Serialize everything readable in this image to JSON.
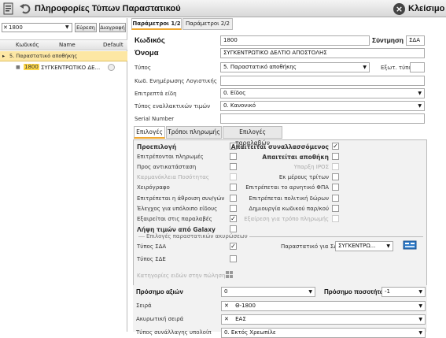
{
  "window": {
    "title": "Πληροφορίες Τύπων Παραστατικού",
    "close_label": "Κλείσιμο"
  },
  "left": {
    "search_value": "1800",
    "search_btn": "Εύρεση",
    "delete_btn": "Διαγραφή",
    "columns": [
      "Κωδικός",
      "Name",
      "Default"
    ],
    "group_label": "5. Παραστατικό αποθήκης",
    "row": {
      "code": "1800",
      "name": "ΣΥΓΚΕΝΤΡΩΤΙΚΟ ΔΕ..."
    }
  },
  "tabs": [
    "Παράμετροι 1/2",
    "Παράμετροι 2/2"
  ],
  "form": {
    "code_label": "Κωδικός",
    "code_value": "1800",
    "synt_label": "Σύντμηση",
    "synt_value": "ΣΔΑ",
    "name_label": "Όνομα",
    "name_value": "ΣΥΓΚΕΝΤΡΩΤΙΚΟ ΔΕΛΤΙΟ ΑΠΟΣΤΟΛΗΣ",
    "type_label": "Τύπος",
    "type_value": "5. Παραστατικό αποθήκης",
    "ext_type_label": "Εξωτ. τύπος",
    "acc_label": "Κωδ. Ενημέρωσης Λογιστικής",
    "items_label": "Επιτρεπτά είδη",
    "items_value": "0. Είδος",
    "alt_price_label": "Τύπος εναλλακτικών τιμών",
    "alt_price_value": "0. Κανονικό",
    "serial_label": "Serial Number"
  },
  "inner_tabs": [
    "Επιλογές",
    "Τρόποι πληρωμής",
    "Επιλογές παραλαβών"
  ],
  "options_left": [
    {
      "label": "Προεπιλογή",
      "checked": false,
      "bold": true
    },
    {
      "label": "Επιτρέπονται πληρωμές",
      "checked": false
    },
    {
      "label": "Προς αντικατάσταση",
      "checked": false
    },
    {
      "label": "Καρμανόκλεια Ποσότητας",
      "checked": false,
      "disabled": true
    },
    {
      "label": "Χειρόγραφο",
      "checked": false
    },
    {
      "label": "Επιτρέπεται η άθροιση συν/γών",
      "checked": false
    },
    {
      "label": "Έλεγχος για υπόλοιπο είδους",
      "checked": false
    },
    {
      "label": "Εξαιρείται στις παραλαβές",
      "checked": true
    },
    {
      "label": "Λήψη τιμών από Galaxy",
      "checked": false,
      "bold": true
    }
  ],
  "options_right": [
    {
      "label": "Απαιτείται συναλλασσόμενος",
      "checked": true,
      "bold": true
    },
    {
      "label": "Απαιτείται αποθήκη",
      "checked": false,
      "bold": true
    },
    {
      "label": "Υπαρξη ΙΡΟΣ",
      "checked": false,
      "disabled": true
    },
    {
      "label": "Εκ μέρους τρίτων",
      "checked": false
    },
    {
      "label": "Επιτρέπεται το αρνητικό ΦΠΑ",
      "checked": false
    },
    {
      "label": "Επιτρέπεται πολιτική δώρων",
      "checked": false
    },
    {
      "label": "Δημιουργία κωδικού παρ/κού",
      "checked": false
    },
    {
      "label": "Εξαίρεση για τρόπο πληρωμής",
      "checked": false,
      "disabled": true
    }
  ],
  "sub_group": {
    "title": "Επιλογές παραστατικών ακυρώσεων",
    "type_sda_label": "Τύπος ΣΔΑ",
    "type_sda_checked": true,
    "type_sde_label": "Τύπος ΣΔΕ",
    "type_sde_checked": false,
    "doc_for_sde_label": "Παραστατικό για ΣΔΕ",
    "doc_for_sde_value": "ΣΥΓΚΕΝΤΡΩ..."
  },
  "categories_label": "Κατηγορίες ειδών στην πώληση",
  "sign_values_label": "Πρόσημο αξιών",
  "sign_values_value": "0",
  "sign_qty_label": "Πρόσημο ποσοτήτων",
  "sign_qty_value": "-1",
  "series_label": "Σειρά",
  "series_value": "Θ-1800",
  "cancel_series_label": "Ακυρωτική σειρά",
  "cancel_series_value": "ΕΑΣ",
  "cut_label": "Τύπος συνάλλαγης υπολοίπ",
  "cut_value": "0. Εκτός Χρεωπίλε"
}
